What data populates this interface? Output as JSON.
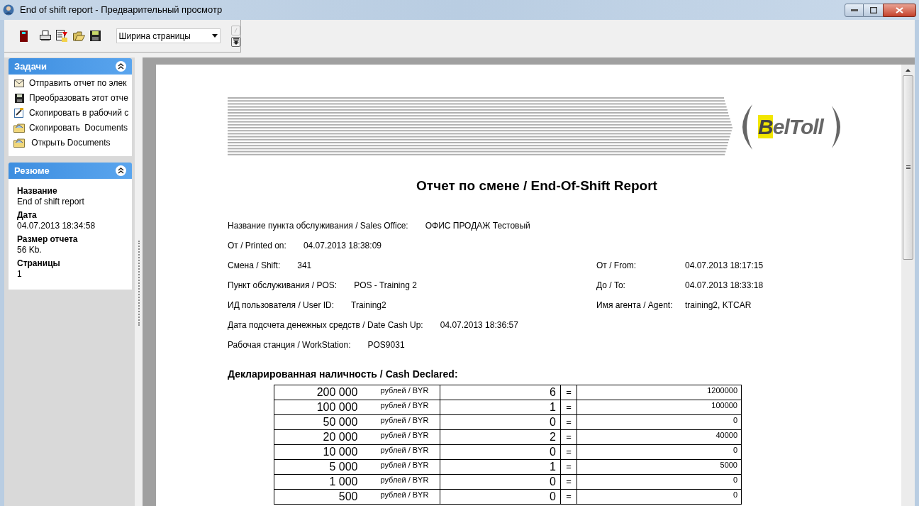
{
  "window": {
    "title": "End of shift report - Предварительный просмотр"
  },
  "toolbar": {
    "zoom_select": {
      "value": "Ширина страницы"
    }
  },
  "tasks_panel": {
    "title": "Задачи",
    "expanded": true,
    "items": [
      {
        "label": "Отправить отчет по элек",
        "kind": "mail"
      },
      {
        "label": "Преобразовать этот отче",
        "kind": "save"
      },
      {
        "label": "Скопировать в рабочий с",
        "kind": "copy"
      },
      {
        "label": "Скопировать  Documents",
        "kind": "folder"
      },
      {
        "label": " Открыть Documents",
        "kind": "folder"
      }
    ]
  },
  "summary_panel": {
    "title": "Резюме",
    "expanded": true,
    "fields": [
      {
        "label": "Название",
        "value": "End of shift report"
      },
      {
        "label": "Дата",
        "value": "04.07.2013 18:34:58"
      },
      {
        "label": "Размер отчета",
        "value": "56 Kb."
      },
      {
        "label": "Страницы",
        "value": "1"
      }
    ]
  },
  "report": {
    "logo_text": "BelToll",
    "title": "Отчет по смене / End-Of-Shift Report",
    "info_rows": [
      {
        "label": "Название пункта обслуживания / Sales Office:",
        "value": "ОФИС ПРОДАЖ Тестовый"
      },
      {
        "label": "От / Printed on:",
        "value": "04.07.2013 18:38:09"
      },
      {
        "label": "Смена / Shift:",
        "value": "341",
        "right_label": "От / From:",
        "right_value": "04.07.2013 18:17:15"
      },
      {
        "label": "Пункт обслуживания / POS:",
        "value": "POS - Training 2",
        "right_label": "До / To:",
        "right_value": "04.07.2013 18:33:18"
      },
      {
        "label": "ИД пользователя / User ID:",
        "value": "Training2",
        "right_label": "Имя агента / Agent:",
        "right_value": "training2, KTCAR"
      },
      {
        "label": "Дата подсчета денежных средств / Date Cash Up:",
        "value": "04.07.2013 18:36:57"
      },
      {
        "label": "Рабочая станция / WorkStation:",
        "value": "POS9031"
      }
    ],
    "cash_heading": "Декларированная наличность / Cash Declared:",
    "cash_rows": [
      {
        "denomination": "200 000",
        "currency": "рублей / BYR",
        "count": "6",
        "equals": "=",
        "total": "1200000"
      },
      {
        "denomination": "100 000",
        "currency": "рублей / BYR",
        "count": "1",
        "equals": "=",
        "total": "100000"
      },
      {
        "denomination": "50 000",
        "currency": "рублей / BYR",
        "count": "0",
        "equals": "=",
        "total": "0"
      },
      {
        "denomination": "20 000",
        "currency": "рублей / BYR",
        "count": "2",
        "equals": "=",
        "total": "40000"
      },
      {
        "denomination": "10 000",
        "currency": "рублей / BYR",
        "count": "0",
        "equals": "=",
        "total": "0"
      },
      {
        "denomination": "5 000",
        "currency": "рублей / BYR",
        "count": "1",
        "equals": "=",
        "total": "5000"
      },
      {
        "denomination": "1 000",
        "currency": "рублей / BYR",
        "count": "0",
        "equals": "=",
        "total": "0"
      },
      {
        "denomination": "500",
        "currency": "рублей / BYR",
        "count": "0",
        "equals": "=",
        "total": "0"
      }
    ]
  }
}
